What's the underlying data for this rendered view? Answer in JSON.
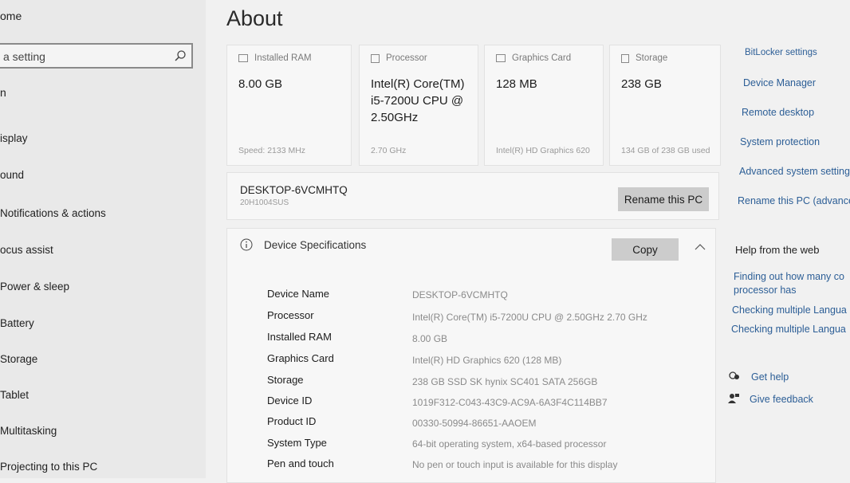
{
  "sidebar": {
    "home": "ome",
    "search_placeholder": "a setting",
    "section": "n",
    "items": [
      "isplay",
      "ound",
      "Notifications & actions",
      "ocus assist",
      "Power & sleep",
      "Battery",
      "Storage",
      "Tablet",
      "Multitasking",
      "Projecting to this PC"
    ]
  },
  "main": {
    "title": "About",
    "cards": [
      {
        "label": "Installed RAM",
        "value": "8.00 GB",
        "sub": "Speed: 2133 MHz",
        "icon": "ram-icon"
      },
      {
        "label": "Processor",
        "value": "Intel(R) Core(TM) i5-7200U CPU @ 2.50GHz",
        "sub": "2.70 GHz",
        "icon": "processor-icon"
      },
      {
        "label": "Graphics Card",
        "value": "128 MB",
        "sub": "Intel(R) HD Graphics 620",
        "icon": "graphics-card-icon"
      },
      {
        "label": "Storage",
        "value": "238 GB",
        "sub": "134 GB of 238 GB used",
        "icon": "storage-icon"
      }
    ],
    "pc_name": "DESKTOP-6VCMHTQ",
    "pc_model": "20H1004SUS",
    "rename_label": "Rename this PC",
    "spec_title": "Device Specifications",
    "copy_label": "Copy",
    "specs": [
      {
        "label": "Device Name",
        "value": "DESKTOP-6VCMHTQ"
      },
      {
        "label": "Processor",
        "value": "Intel(R) Core(TM) i5-7200U CPU @ 2.50GHz   2.70 GHz"
      },
      {
        "label": "Installed RAM",
        "value": "8.00 GB"
      },
      {
        "label": "Graphics Card",
        "value": "Intel(R) HD Graphics 620 (128 MB)"
      },
      {
        "label": "Storage",
        "value": "238 GB SSD SK hynix SC401 SATA 256GB"
      },
      {
        "label": "Device ID",
        "value": "1019F312-C043-43C9-AC9A-6A3F4C114BB7"
      },
      {
        "label": "Product ID",
        "value": "00330-50994-86651-AAOEM"
      },
      {
        "label": "System Type",
        "value": "64-bit operating system, x64-based processor"
      },
      {
        "label": "Pen and touch",
        "value": "No pen or touch input is available for this display"
      }
    ]
  },
  "right": {
    "links": [
      "BitLocker settings",
      "Device Manager",
      "Remote desktop",
      "System protection",
      "Advanced system setting",
      "Rename this PC (advance"
    ],
    "help_heading": "Help from the web",
    "web_links": [
      "Finding out how many co",
      "processor has",
      "Checking multiple Langua",
      "Checking multiple Langua"
    ],
    "get_help": "Get help",
    "give_feedback": "Give feedback"
  },
  "colors": {
    "link": "#2c5e96",
    "button": "#cccccc",
    "card_bg": "#f7f7f7",
    "sidebar_bg": "#e9e9e9"
  }
}
